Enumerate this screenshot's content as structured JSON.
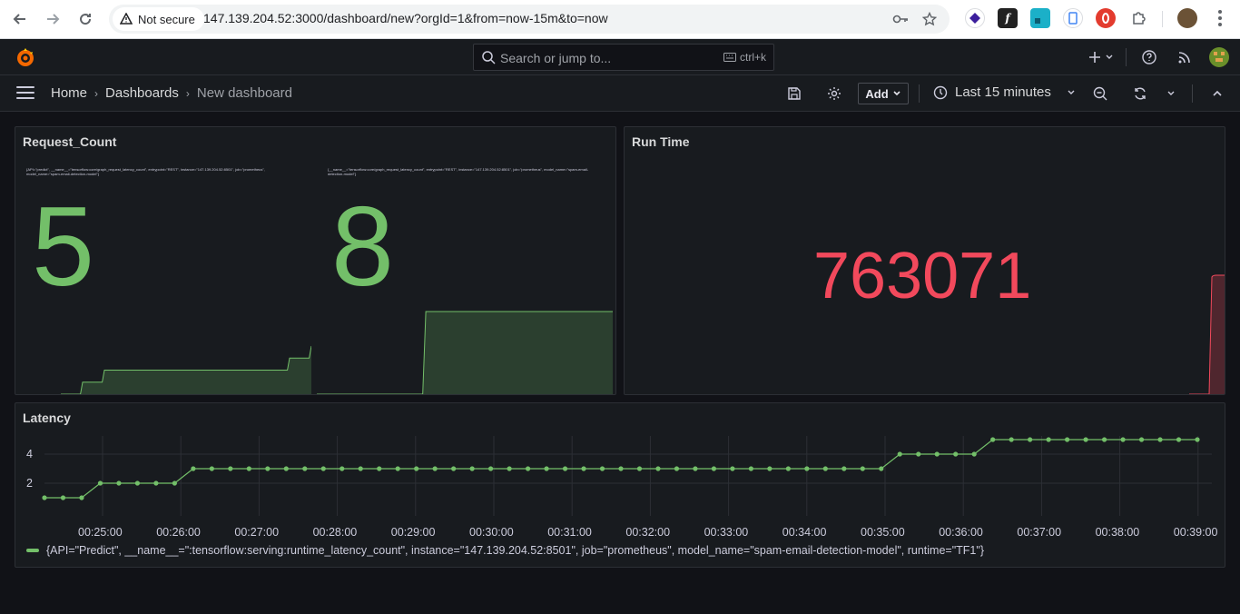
{
  "browser": {
    "security_label": "Not secure",
    "url": "147.139.204.52:3000/dashboard/new?orgId=1&from=now-15m&to=now"
  },
  "topbar": {
    "search_placeholder": "Search or jump to...",
    "search_shortcut": "ctrl+k"
  },
  "breadcrumb": {
    "home": "Home",
    "dashboards": "Dashboards",
    "current": "New dashboard"
  },
  "toolbar": {
    "add_label": "Add",
    "time_range": "Last 15 minutes"
  },
  "panels": {
    "request_count": {
      "title": "Request_Count",
      "stats": [
        {
          "label": "{API=\"predict\", __name__=\"tensorflow:core/graph_request_latency_count\", entrypoint=\"REST\", instance=\"147.139.204.52:8501\", job=\"prometheus\", model_name=\"spam-email-detection-model\"}",
          "value": "5",
          "sparkline": [
            0,
            0,
            1,
            1,
            2,
            2,
            2,
            2,
            2,
            2,
            2,
            2,
            2,
            2,
            2,
            2,
            2,
            2,
            2,
            2,
            2,
            3,
            3,
            4
          ]
        },
        {
          "label": "{__name__=\"tensorflow:core/graph_request_latency_count\", entrypoint=\"REST\", instance=\"147.139.204.52:8501\", job=\"prometheus\", model_name=\"spam-email-detection-model\"}",
          "value": "8",
          "sparkline": [
            7,
            7,
            7,
            7,
            7,
            7,
            7,
            8,
            8,
            8,
            8,
            8,
            8,
            8,
            8,
            8,
            8,
            8,
            8,
            8
          ]
        }
      ],
      "color": "#73bf69"
    },
    "run_time": {
      "title": "Run Time",
      "value": "763071",
      "color": "#f2495c"
    },
    "latency": {
      "title": "Latency",
      "legend": "{API=\"Predict\", __name__=\":tensorflow:serving:runtime_latency_count\", instance=\"147.139.204.52:8501\", job=\"prometheus\", model_name=\"spam-email-detection-model\", runtime=\"TF1\"}",
      "color": "#73bf69"
    }
  },
  "chart_data": {
    "type": "line",
    "title": "Latency",
    "xlabel": "",
    "ylabel": "",
    "yticks": [
      "2",
      "4"
    ],
    "xticks": [
      "00:25:00",
      "00:26:00",
      "00:27:00",
      "00:28:00",
      "00:29:00",
      "00:30:00",
      "00:31:00",
      "00:32:00",
      "00:33:00",
      "00:34:00",
      "00:35:00",
      "00:36:00",
      "00:37:00",
      "00:38:00",
      "00:39:00"
    ],
    "ylim": [
      0,
      5
    ],
    "series": [
      {
        "name": "{API=\"Predict\", __name__=\":tensorflow:serving:runtime_latency_count\", instance=\"147.139.204.52:8501\", job=\"prometheus\", model_name=\"spam-email-detection-model\", runtime=\"TF1\"}",
        "values": [
          1,
          1,
          1,
          2,
          2,
          2,
          2,
          2,
          3,
          3,
          3,
          3,
          3,
          3,
          3,
          3,
          3,
          3,
          3,
          3,
          3,
          3,
          3,
          3,
          3,
          3,
          3,
          3,
          3,
          3,
          3,
          3,
          3,
          3,
          3,
          3,
          3,
          3,
          3,
          3,
          3,
          3,
          3,
          3,
          3,
          3,
          4,
          4,
          4,
          4,
          4,
          5,
          5,
          5,
          5,
          5,
          5,
          5,
          5,
          5,
          5,
          5,
          5
        ]
      }
    ],
    "grid": true,
    "legend": "bottom-left"
  }
}
